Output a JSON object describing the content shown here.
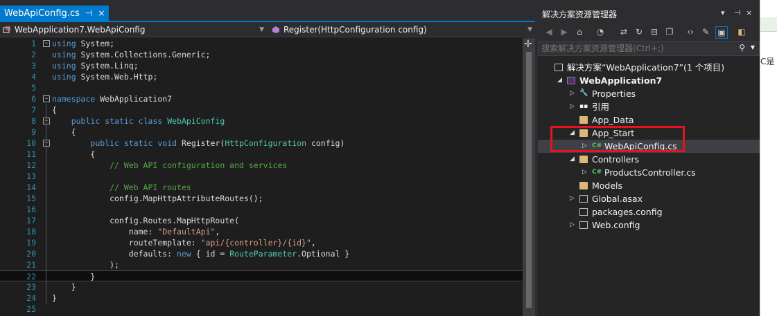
{
  "editor": {
    "tab": {
      "title": "WebApiConfig.cs",
      "pin_icon": "⊣",
      "close_icon": "×"
    },
    "nav": {
      "class_path": "WebApplication7.WebApiConfig",
      "member": "Register(HttpConfiguration config)"
    },
    "lines": [
      {
        "n": "1",
        "fold": "−",
        "html": "<span class=\"kw\">using</span> System;"
      },
      {
        "n": "2",
        "fold": "",
        "html": "<span class=\"kw\">using</span> System.Collections.Generic;"
      },
      {
        "n": "3",
        "fold": "",
        "html": "<span class=\"kw\">using</span> System.Linq;"
      },
      {
        "n": "4",
        "fold": "",
        "html": "<span class=\"kw\">using</span> System.Web.Http;"
      },
      {
        "n": "5",
        "fold": "",
        "html": ""
      },
      {
        "n": "6",
        "fold": "−",
        "html": "<span class=\"kw\">namespace</span> WebApplication7"
      },
      {
        "n": "7",
        "fold": "",
        "html": "{"
      },
      {
        "n": "8",
        "fold": "−",
        "html": "    <span class=\"kw\">public</span> <span class=\"kw\">static</span> <span class=\"kw\">class</span> <span class=\"ty\">WebApiConfig</span>"
      },
      {
        "n": "9",
        "fold": "",
        "html": "    {"
      },
      {
        "n": "10",
        "fold": "−",
        "html": "        <span class=\"kw\">public</span> <span class=\"kw\">static</span> <span class=\"kw\">void</span> Register(<span class=\"ty\">HttpConfiguration</span> config)"
      },
      {
        "n": "11",
        "fold": "",
        "html": "        {"
      },
      {
        "n": "12",
        "fold": "",
        "html": "            <span class=\"cm\">// Web API configuration and services</span>"
      },
      {
        "n": "13",
        "fold": "",
        "html": ""
      },
      {
        "n": "14",
        "fold": "",
        "html": "            <span class=\"cm\">// Web API routes</span>"
      },
      {
        "n": "15",
        "fold": "",
        "html": "            config.MapHttpAttributeRoutes();"
      },
      {
        "n": "16",
        "fold": "",
        "html": ""
      },
      {
        "n": "17",
        "fold": "",
        "html": "            config.Routes.MapHttpRoute("
      },
      {
        "n": "18",
        "fold": "",
        "html": "                name: <span class=\"st\">\"DefaultApi\"</span>,"
      },
      {
        "n": "19",
        "fold": "",
        "html": "                routeTemplate: <span class=\"st\">\"api/{controller}/{id}\"</span>,"
      },
      {
        "n": "20",
        "fold": "",
        "html": "                defaults: <span class=\"kw\">new</span> { id = <span class=\"ty\">RouteParameter</span>.Optional }"
      },
      {
        "n": "21",
        "fold": "",
        "html": "            );"
      },
      {
        "n": "22",
        "fold": "",
        "html": "        }",
        "current": true
      },
      {
        "n": "23",
        "fold": "",
        "html": "    }"
      },
      {
        "n": "24",
        "fold": "",
        "html": "}"
      },
      {
        "n": "25",
        "fold": "",
        "html": ""
      }
    ]
  },
  "solution_explorer": {
    "title": "解决方案资源管理器",
    "title_buttons": [
      "▾",
      "⊣",
      "×"
    ],
    "toolbar_icons": [
      "back-icon",
      "forward-icon",
      "home-icon",
      "history-icon",
      "sync-icon",
      "refresh-icon",
      "collapse-all-icon",
      "copy-icon",
      "code-view-icon",
      "properties-icon",
      "show-all-files-icon",
      "preview-icon"
    ],
    "search_placeholder": "搜索解决方案资源管理器(Ctrl+;)",
    "tree": [
      {
        "label": "解决方案“WebApplication7”(1 个项目)",
        "icon": "solution-icon",
        "indent": 0,
        "arrow": ""
      },
      {
        "label": "WebApplication7",
        "icon": "project-icon",
        "indent": 1,
        "arrow": "◢",
        "bold": true
      },
      {
        "label": "Properties",
        "icon": "wrench-icon",
        "indent": 2,
        "arrow": "▷"
      },
      {
        "label": "引用",
        "icon": "references-icon",
        "indent": 2,
        "arrow": "▷"
      },
      {
        "label": "App_Data",
        "icon": "folder-icon",
        "indent": 2,
        "arrow": ""
      },
      {
        "label": "App_Start",
        "icon": "folder-open-icon",
        "indent": 2,
        "arrow": "◢"
      },
      {
        "label": "WebApiConfig.cs",
        "icon": "csharp-file-icon",
        "indent": 3,
        "arrow": "▷",
        "selected": true
      },
      {
        "label": "Controllers",
        "icon": "folder-open-icon",
        "indent": 2,
        "arrow": "◢"
      },
      {
        "label": "ProductsController.cs",
        "icon": "csharp-file-icon",
        "indent": 3,
        "arrow": "▷"
      },
      {
        "label": "Models",
        "icon": "folder-icon",
        "indent": 2,
        "arrow": ""
      },
      {
        "label": "Global.asax",
        "icon": "global-asax-icon",
        "indent": 2,
        "arrow": "▷"
      },
      {
        "label": "packages.config",
        "icon": "config-file-icon",
        "indent": 2,
        "arrow": ""
      },
      {
        "label": "Web.config",
        "icon": "config-file-icon",
        "indent": 2,
        "arrow": "▷"
      }
    ]
  },
  "right_strip": {
    "text": "C是"
  }
}
